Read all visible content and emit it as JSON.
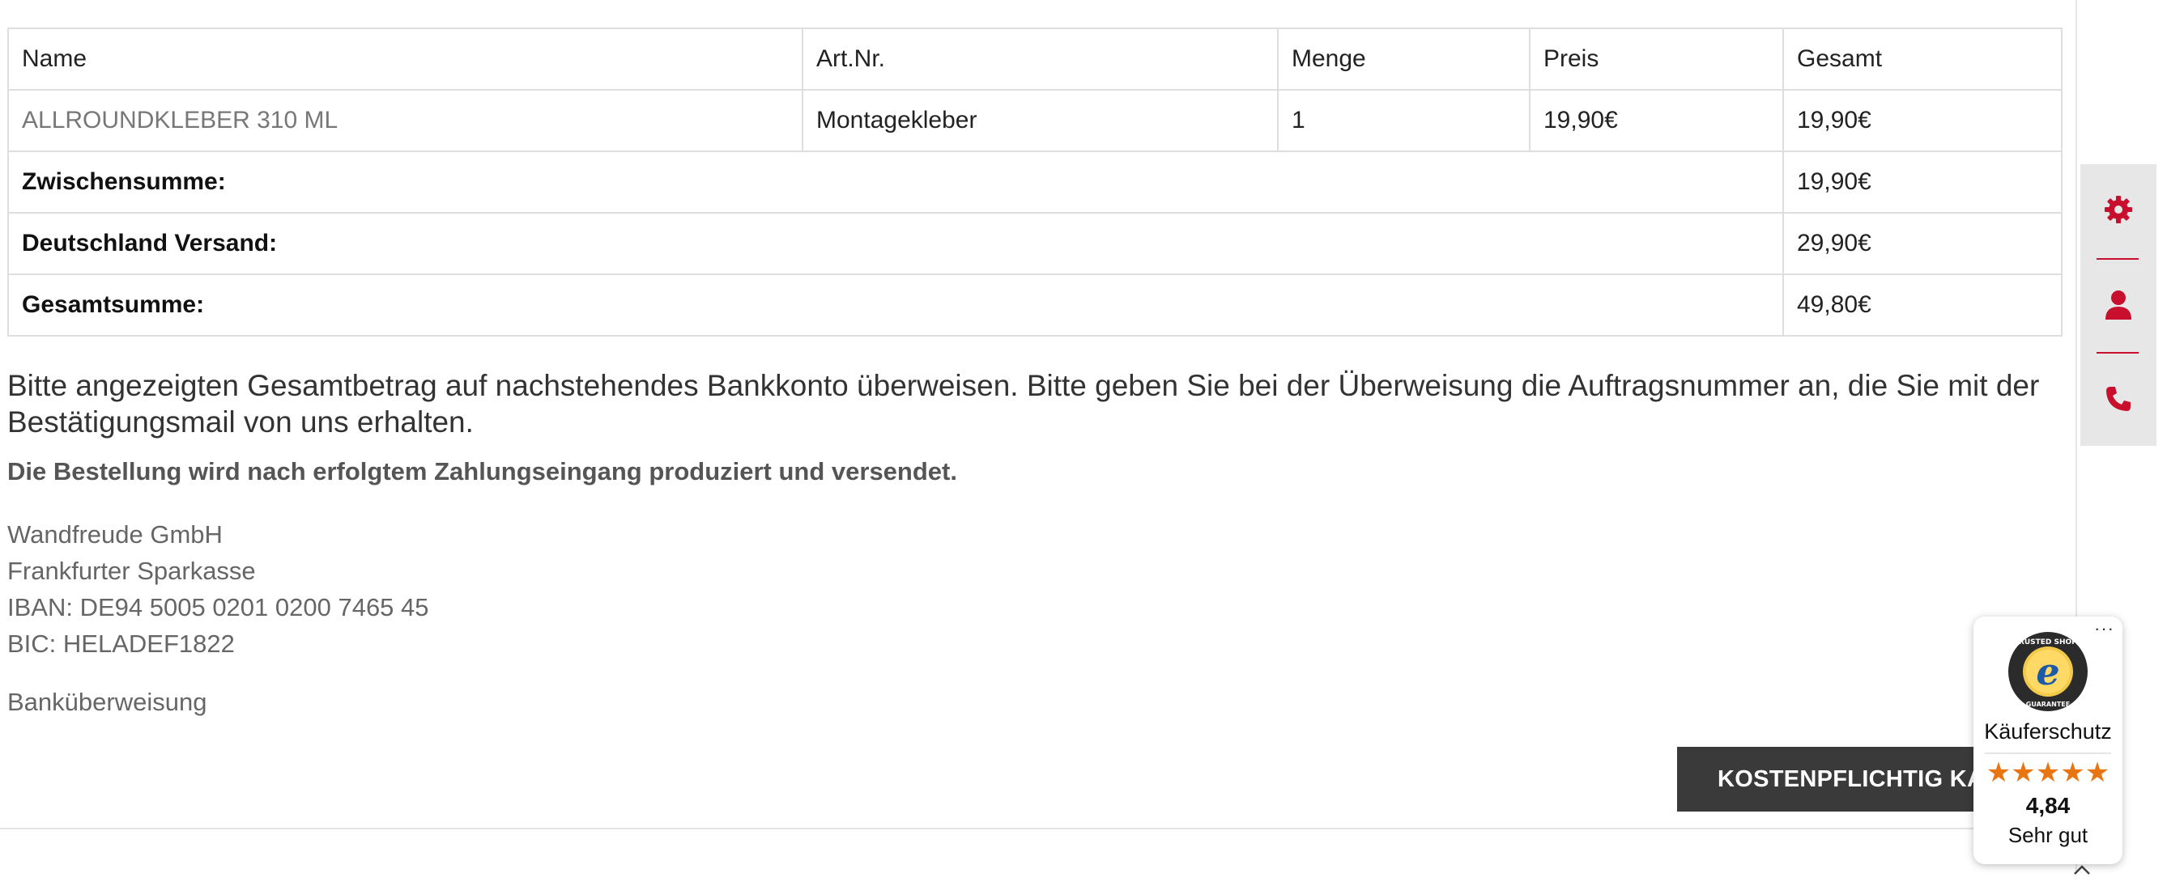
{
  "order_table": {
    "headers": [
      "Name",
      "Art.Nr.",
      "Menge",
      "Preis",
      "Gesamt"
    ],
    "items": [
      {
        "name": "ALLROUNDKLEBER 310 ML",
        "art_nr": "Montagekleber",
        "menge": "1",
        "preis": "19,90€",
        "gesamt": "19,90€"
      }
    ],
    "subtotal": {
      "label": "Zwischensumme:",
      "value": "19,90€"
    },
    "shipping": {
      "label": "Deutschland Versand:",
      "value": "29,90€"
    },
    "total": {
      "label": "Gesamtsumme:",
      "value": "49,80€"
    }
  },
  "instructions": "Bitte angezeigten Gesamtbetrag auf nachstehendes Bankkonto überweisen. Bitte geben Sie bei der Überweisung die Auftragsnummer an, die Sie mit der Bestätigungsmail von uns erhalten.",
  "production_note": "Die Bestellung wird nach erfolgtem Zahlungseingang produziert und versendet.",
  "bank": {
    "company": "Wandfreude GmbH",
    "bank_name": "Frankfurter Sparkasse",
    "iban": "IBAN: DE94 5005 0201 0200 7465 45",
    "bic": "BIC: HELADEF1822"
  },
  "payment_method": "Banküberweisung",
  "buy_button": "KOSTENPFLICHTIG KAUFEN",
  "side_toolbar": {
    "icons": [
      "gear-icon",
      "user-icon",
      "phone-icon"
    ],
    "accent": "#c8102e"
  },
  "trusted_shops": {
    "more": "···",
    "label": "Käuferschutz",
    "stars": "★★★★★",
    "score": "4,84",
    "rating_text": "Sehr gut",
    "seal_text": "TRUSTED SHOPS",
    "seal_bottom": "GUARANTEE",
    "seal_letter": "e",
    "star_color": "#e87511"
  }
}
